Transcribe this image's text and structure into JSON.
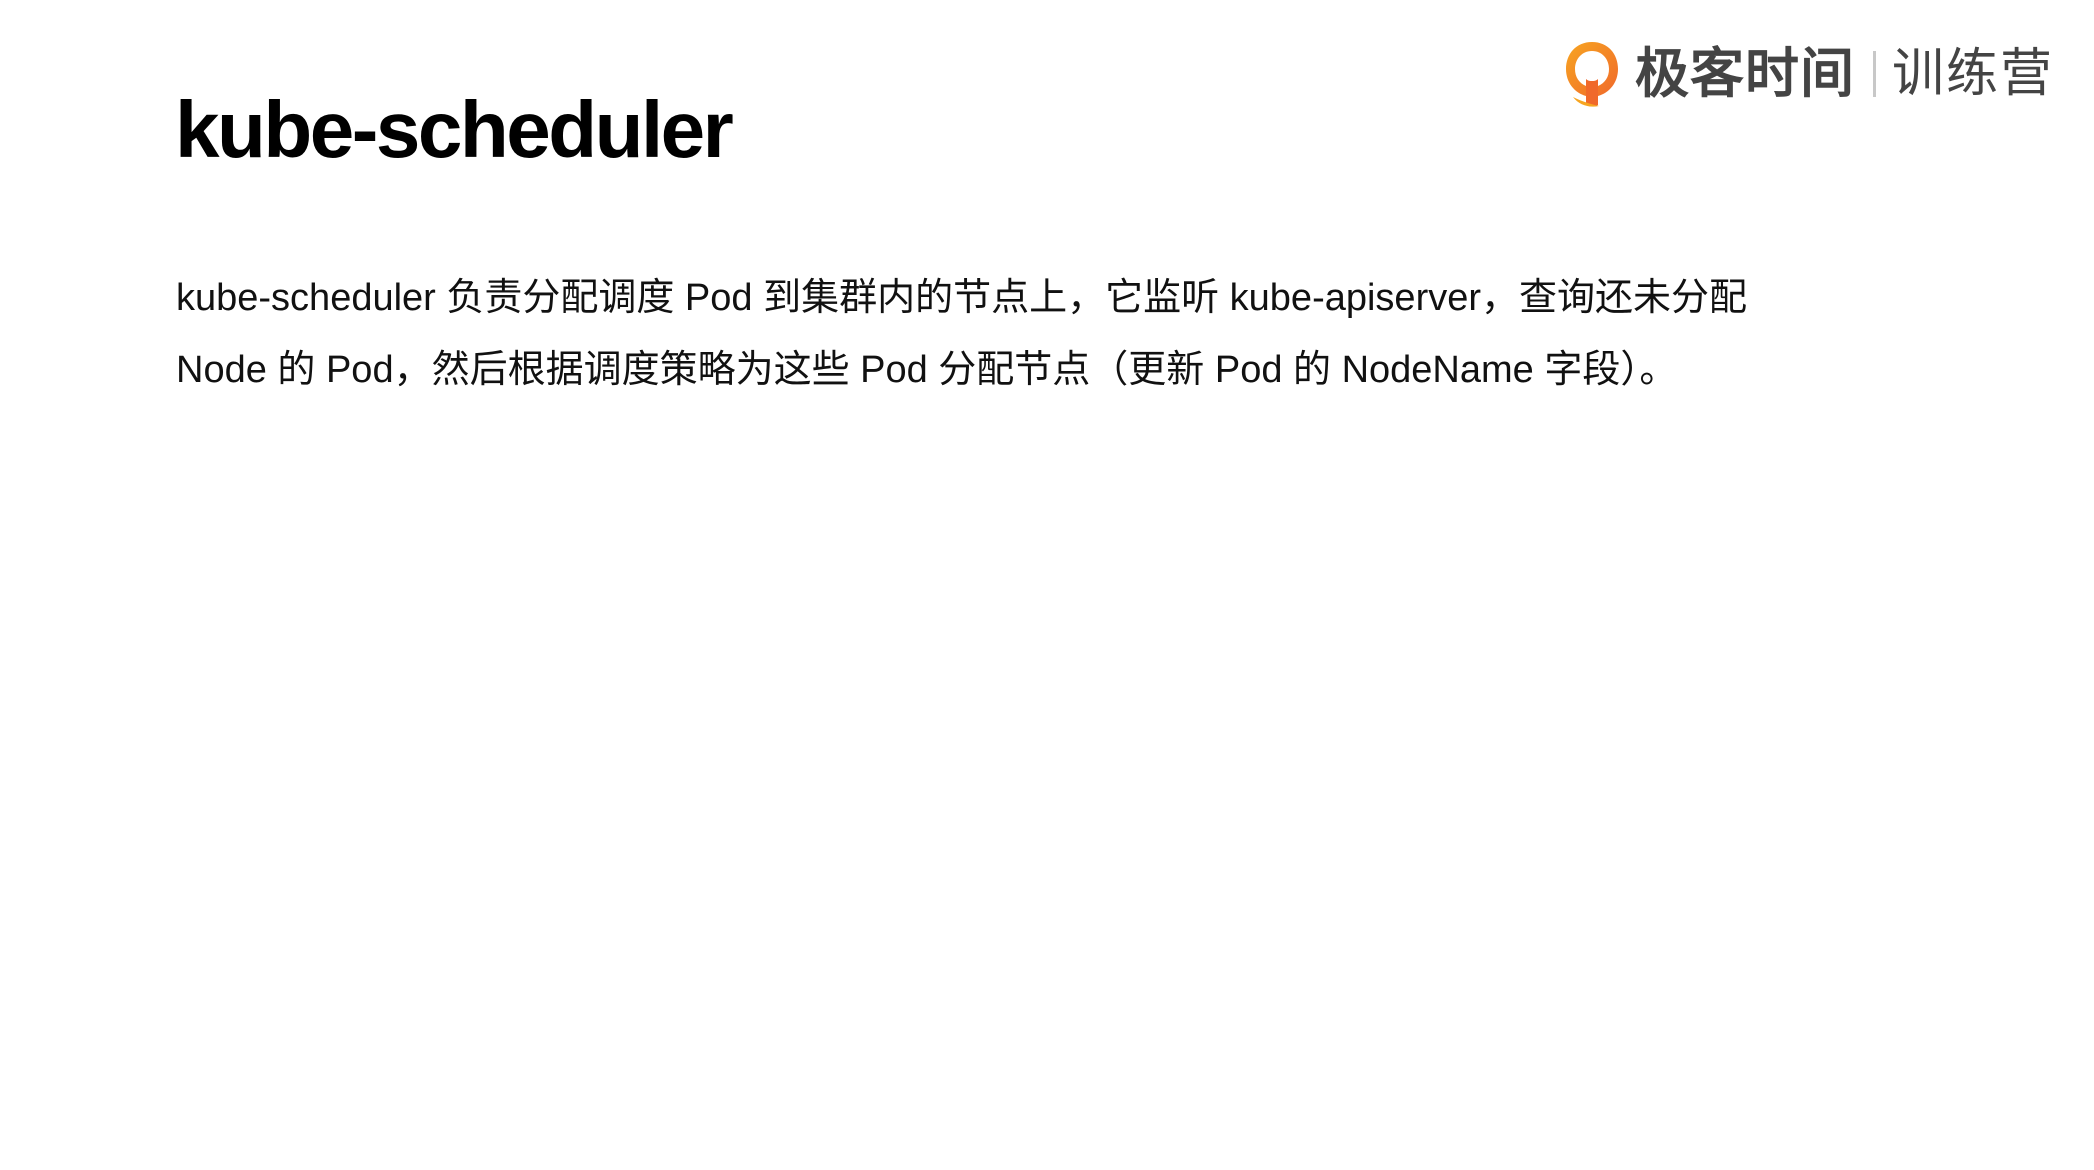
{
  "slide": {
    "title": "kube-scheduler",
    "body_lines": [
      "kube-scheduler 负责分配调度 Pod 到集群内的节点上，它监听 kube-apiserver，查询还未分配",
      "Node 的 Pod，然后根据调度策略为这些 Pod 分配节点（更新 Pod 的 NodeName 字段）。"
    ]
  },
  "brand": {
    "logo_icon": "geektime-logo-icon",
    "name": "极客时间",
    "sub": "训练营",
    "colors": {
      "logo_orange": "#F0692B",
      "logo_yellow": "#F7A521",
      "text": "#444444"
    }
  }
}
